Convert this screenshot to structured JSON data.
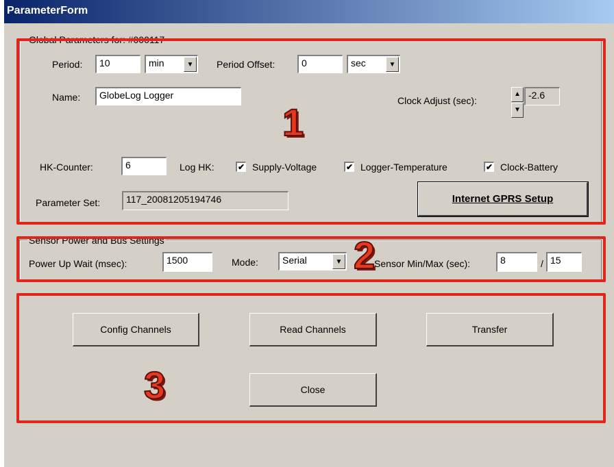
{
  "window": {
    "title": "ParameterForm"
  },
  "global": {
    "legend": "Global Parameters for: #000117",
    "period_label": "Period:",
    "period_value": "10",
    "period_unit": "min",
    "offset_label": "Period Offset:",
    "offset_value": "0",
    "offset_unit": "sec",
    "name_label": "Name:",
    "name_value": "GlobeLog Logger",
    "clock_label": "Clock Adjust (sec):",
    "clock_value": "-2.6",
    "hk_counter_label": "HK-Counter:",
    "hk_counter_value": "6",
    "log_hk_label": "Log HK:",
    "log_items": [
      {
        "label": "Supply-Voltage",
        "checked": true
      },
      {
        "label": "Logger-Temperature",
        "checked": true
      },
      {
        "label": "Clock-Battery",
        "checked": true
      }
    ],
    "paramset_label": "Parameter Set:",
    "paramset_value": "117_20081205194746",
    "gprs_button": "Internet GPRS Setup"
  },
  "sensor": {
    "legend": "Sensor Power and Bus Settings",
    "powerup_label": "Power Up Wait  (msec):",
    "powerup_value": "1500",
    "mode_label": "Mode:",
    "mode_value": "Serial",
    "minmax_label": "Sensor Min/Max (sec):",
    "min_value": "8",
    "separator": "/",
    "max_value": "15"
  },
  "actions": {
    "config": "Config Channels",
    "read": "Read Channels",
    "transfer": "Transfer",
    "close": "Close"
  },
  "annotations": {
    "n1": "1",
    "n2": "2",
    "n3": "3",
    "color": "#e0261c"
  }
}
